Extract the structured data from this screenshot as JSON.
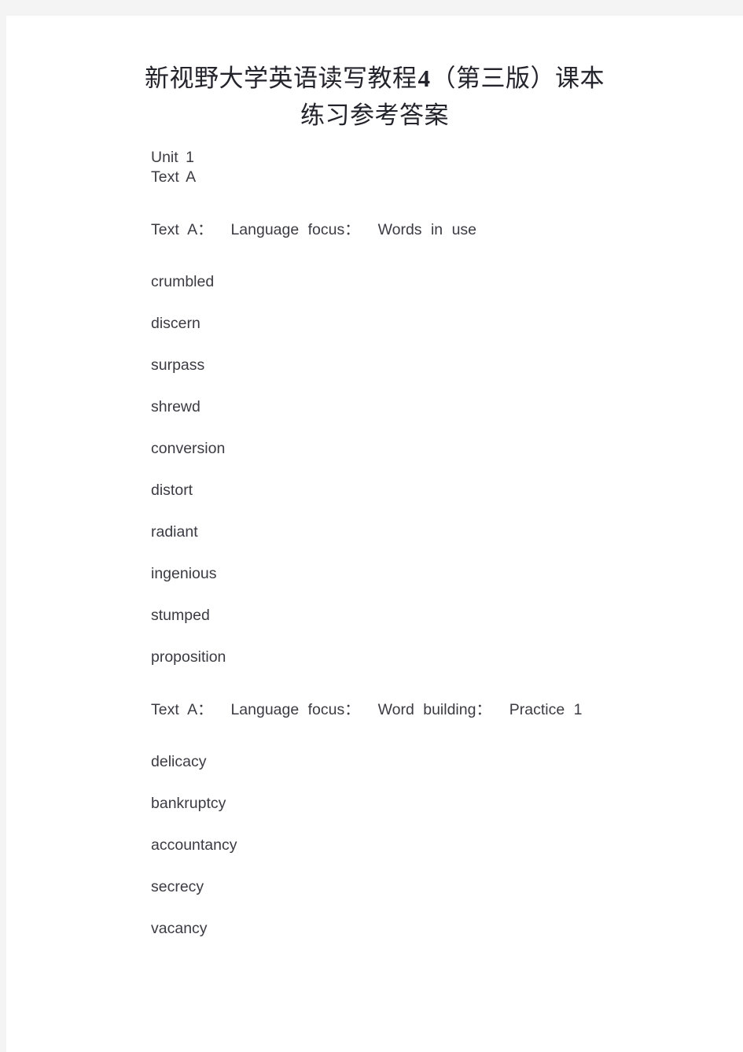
{
  "document": {
    "title_line_1_prefix": "新视野大学英语读写教程",
    "title_number": "4",
    "title_line_1_suffix": "（第三版）课本",
    "title_line_2": "练习参考答案",
    "page_background": "#ffffff",
    "gutter_color": "#f4f4f4",
    "text_color": "#3b3b43",
    "title_color": "#23232b"
  },
  "meta": {
    "unit": "Unit 1",
    "text": "Text A"
  },
  "sections": [
    {
      "heading": "Text A：  Language focus：  Words in use",
      "answers": [
        "crumbled",
        "discern",
        "surpass",
        "shrewd",
        "conversion",
        "distort",
        "radiant",
        "ingenious",
        "stumped",
        "proposition"
      ]
    },
    {
      "heading": "Text A：  Language focus：  Word building：  Practice 1",
      "answers": [
        "delicacy",
        "bankruptcy",
        "accountancy",
        "secrecy",
        "vacancy"
      ]
    }
  ]
}
